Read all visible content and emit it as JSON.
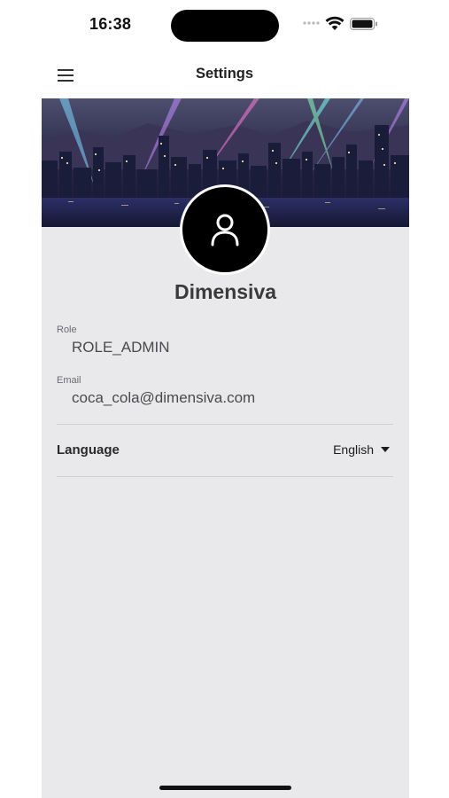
{
  "status_bar": {
    "time": "16:38"
  },
  "nav": {
    "title": "Settings",
    "menu_icon": "hamburger-menu-icon"
  },
  "profile": {
    "banner_image": "city-skyline-night-banner",
    "avatar_icon": "user-profile-icon",
    "name": "Dimensiva"
  },
  "fields": {
    "role": {
      "label": "Role",
      "value": "ROLE_ADMIN"
    },
    "email": {
      "label": "Email",
      "value": "coca_cola@dimensiva.com"
    }
  },
  "language": {
    "label": "Language",
    "selected": "English",
    "dropdown_icon": "caret-down-icon"
  },
  "colors": {
    "panel_bg": "#e9e9ec",
    "avatar_bg": "#000000",
    "divider": "#d0d0d4"
  }
}
